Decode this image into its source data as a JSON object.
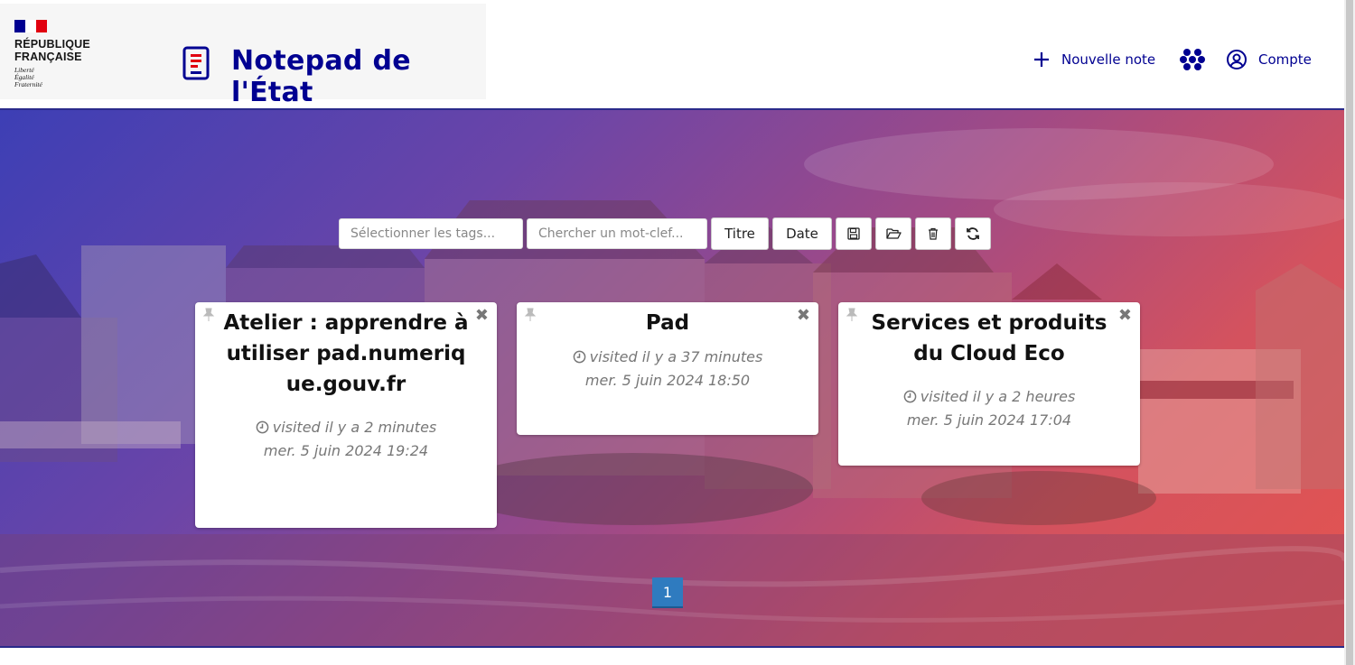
{
  "header": {
    "rf_lines": [
      "RÉPUBLIQUE",
      "FRANÇAISE"
    ],
    "devise_lines": [
      "Liberté",
      "Égalité",
      "Fraternité"
    ],
    "app_title": "Notepad de l'État",
    "nav": {
      "new_note": "Nouvelle note",
      "apps_icon": "apps-grid-icon",
      "account": "Compte"
    }
  },
  "toolbar": {
    "tags_placeholder": "Sélectionner les tags...",
    "keyword_placeholder": "Chercher un mot-clef...",
    "sort_title": "Titre",
    "sort_date": "Date",
    "icons": [
      "save-icon",
      "folder-open-icon",
      "trash-icon",
      "refresh-icon"
    ]
  },
  "notes": [
    {
      "title": "Atelier : apprendre à utiliser pad.numerique.gouv.fr",
      "visited": "visited il y a 2 minutes",
      "date": "mer. 5 juin 2024 19:24"
    },
    {
      "title": "Pad",
      "visited": "visited il y a 37 minutes",
      "date": "mer. 5 juin 2024 18:50"
    },
    {
      "title": "Services et produits du Cloud Eco",
      "visited": "visited il y a 2 heures",
      "date": "mer. 5 juin 2024 17:04"
    }
  ],
  "pagination": {
    "current": "1"
  },
  "colors": {
    "brand_blue": "#000091",
    "marianne_red": "#e1000f",
    "pager_blue": "#2f7bbf"
  }
}
